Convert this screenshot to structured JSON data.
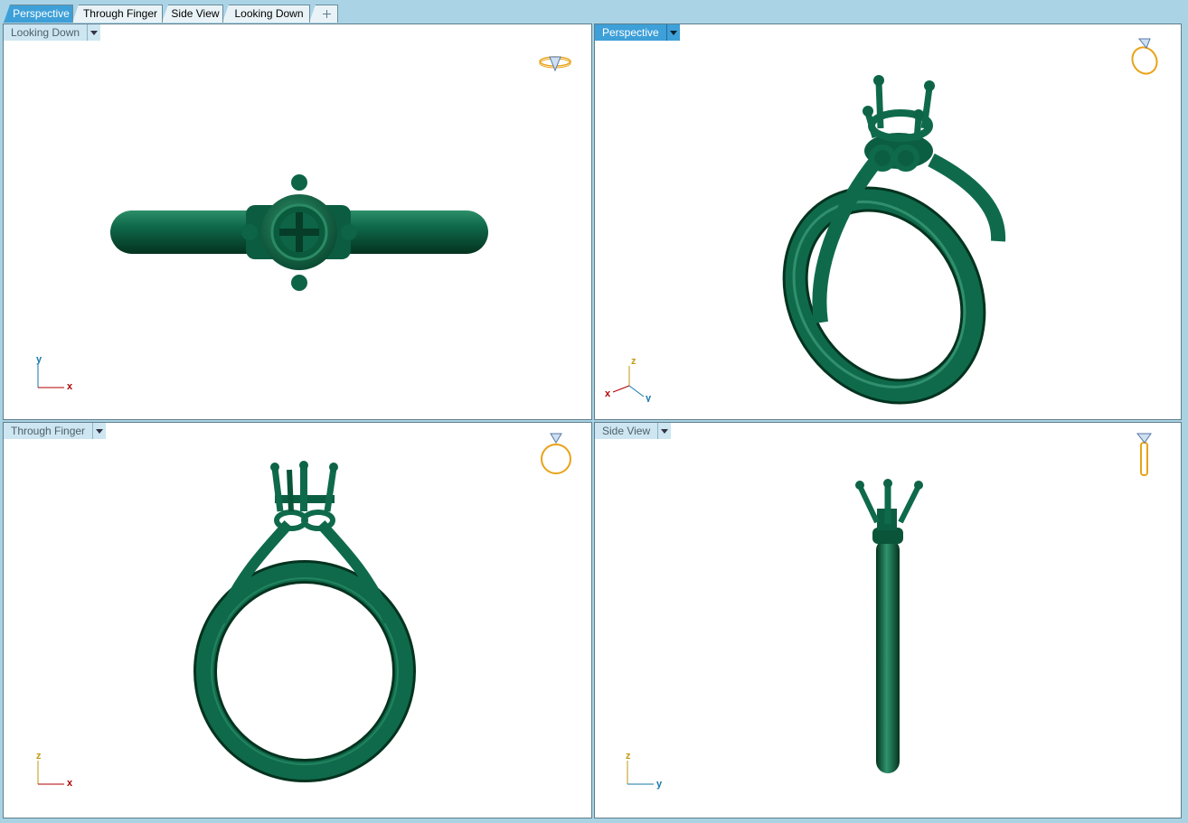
{
  "tabs": [
    {
      "label": "Perspective",
      "active": true
    },
    {
      "label": "Through Finger",
      "active": false
    },
    {
      "label": "Side View",
      "active": false
    },
    {
      "label": "Looking Down",
      "active": false
    }
  ],
  "viewports": {
    "top_left": {
      "label": "Looking Down",
      "active": false,
      "axes": {
        "vertical": "y",
        "horizontal": "x"
      }
    },
    "top_right": {
      "label": "Perspective",
      "active": true,
      "axes": {
        "vertical": "z",
        "horizontal": "x",
        "third": "y"
      }
    },
    "bottom_left": {
      "label": "Through Finger",
      "active": false,
      "axes": {
        "vertical": "z",
        "horizontal": "x"
      }
    },
    "bottom_right": {
      "label": "Side View",
      "active": false,
      "axes": {
        "vertical": "z",
        "horizontal": "y"
      }
    }
  },
  "colors": {
    "model": "#0f6a4c",
    "model_dark": "#053a28",
    "model_light": "#3fa07c",
    "active_tab": "#3ea0d8",
    "background": "#a9d3e3",
    "axis_x": "#b00000",
    "axis_y": "#1677a8",
    "axis_z": "#c29a10",
    "nav_gold": "#e8a317"
  },
  "icons": [
    "plus-icon",
    "dropdown-arrow-icon",
    "ring-nav-icon",
    "axis-icon"
  ]
}
